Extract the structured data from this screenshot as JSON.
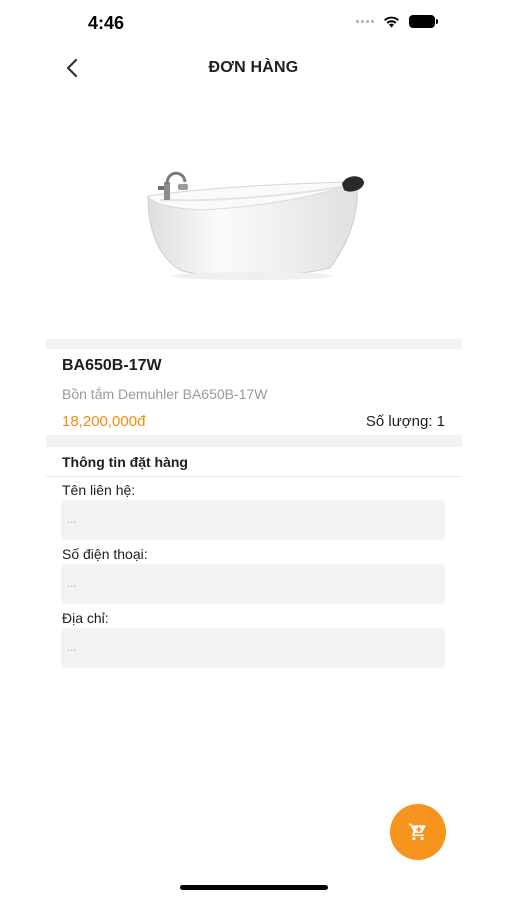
{
  "status_bar": {
    "time": "4:46",
    "wifi_icon": "wifi-icon",
    "battery_icon": "battery-icon",
    "signal_icon": "signal-icon"
  },
  "header": {
    "title": "ĐƠN HÀNG",
    "back_icon": "chevron-left-icon"
  },
  "product": {
    "image_icon": "bathtub-image",
    "code": "BA650B-17W",
    "name": "Bồn tắm Demuhler BA650B-17W",
    "price": "18,200,000đ",
    "quantity": "Số lượng: 1"
  },
  "order_form": {
    "title": "Thông tin đặt hàng",
    "contact_name": {
      "label": "Tên liên hệ:",
      "placeholder": "..."
    },
    "phone": {
      "label": "Số điện thoại:",
      "placeholder": "..."
    },
    "address": {
      "label": "Địa chỉ:",
      "placeholder": "..."
    }
  },
  "cart_button": {
    "icon": "cart-icon"
  },
  "colors": {
    "accent": "#f7941d",
    "price": "#f58b0b",
    "input_bg": "#f2f2f2",
    "muted_text": "#9a9a9a"
  }
}
